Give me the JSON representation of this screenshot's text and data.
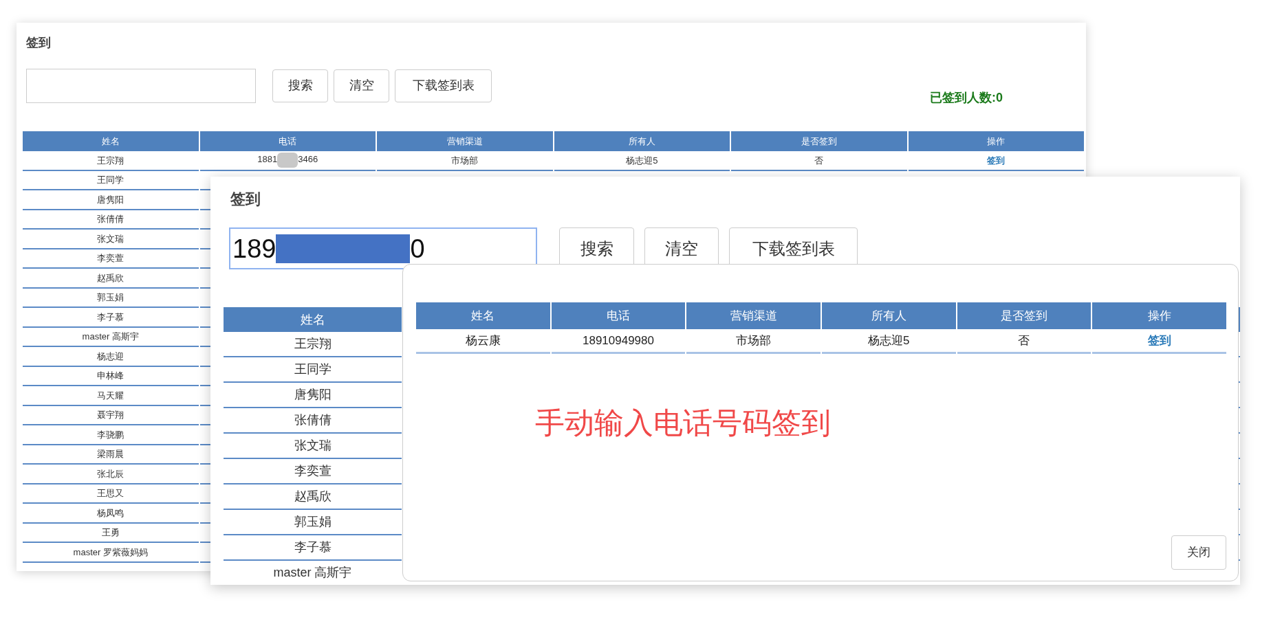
{
  "back_window": {
    "title": "签到",
    "buttons": [
      "搜索",
      "清空",
      "下载签到表"
    ],
    "signed_count": "已签到人数:0",
    "table": {
      "columns": [
        "姓名",
        "电话",
        "营销渠道",
        "所有人",
        "是否签到",
        "操作"
      ],
      "rows": [
        {
          "name": "王宗翔",
          "phone_start": "1881",
          "phone_end": "3466",
          "channel": "市场部",
          "owner": "杨志迎5",
          "signed": "否",
          "action": "签到"
        },
        {
          "name": "王同学"
        },
        {
          "name": "唐隽阳"
        },
        {
          "name": "张倩倩"
        },
        {
          "name": "张文瑞"
        },
        {
          "name": "李奕萱"
        },
        {
          "name": "赵禹欣"
        },
        {
          "name": "郭玉娟"
        },
        {
          "name": "李子慕"
        },
        {
          "name": "master 高斯宇"
        },
        {
          "name": "杨志迎"
        },
        {
          "name": "申林峰"
        },
        {
          "name": "马天耀"
        },
        {
          "name": "聂宇翔"
        },
        {
          "name": "李骁鹏"
        },
        {
          "name": "梁雨晨"
        },
        {
          "name": "张北辰"
        },
        {
          "name": "王思又"
        },
        {
          "name": "杨凤鸣"
        },
        {
          "name": "王勇"
        },
        {
          "name": "master 罗紫薇妈妈"
        }
      ]
    }
  },
  "front_window": {
    "title": "签到",
    "search": {
      "value_start": "189",
      "value_end": "0"
    },
    "buttons": [
      "搜索",
      "清空",
      "下载签到表"
    ],
    "table": {
      "columns": [
        "姓名"
      ],
      "rows": [
        {
          "name": "王宗翔"
        },
        {
          "name": "王同学"
        },
        {
          "name": "唐隽阳"
        },
        {
          "name": "张倩倩"
        },
        {
          "name": "张文瑞"
        },
        {
          "name": "李奕萱"
        },
        {
          "name": "赵禹欣"
        },
        {
          "name": "郭玉娟"
        },
        {
          "name": "李子慕"
        },
        {
          "name": "master 高斯宇"
        }
      ]
    }
  },
  "dialog": {
    "table": {
      "columns": [
        "姓名",
        "电话",
        "营销渠道",
        "所有人",
        "是否签到",
        "操作"
      ],
      "rows": [
        {
          "name": "杨云康",
          "phone": "18910949980",
          "channel": "市场部",
          "owner": "杨志迎5",
          "signed": "否",
          "action": "签到"
        }
      ]
    },
    "note": "手动输入电话号码签到",
    "close_button": "关闭"
  }
}
